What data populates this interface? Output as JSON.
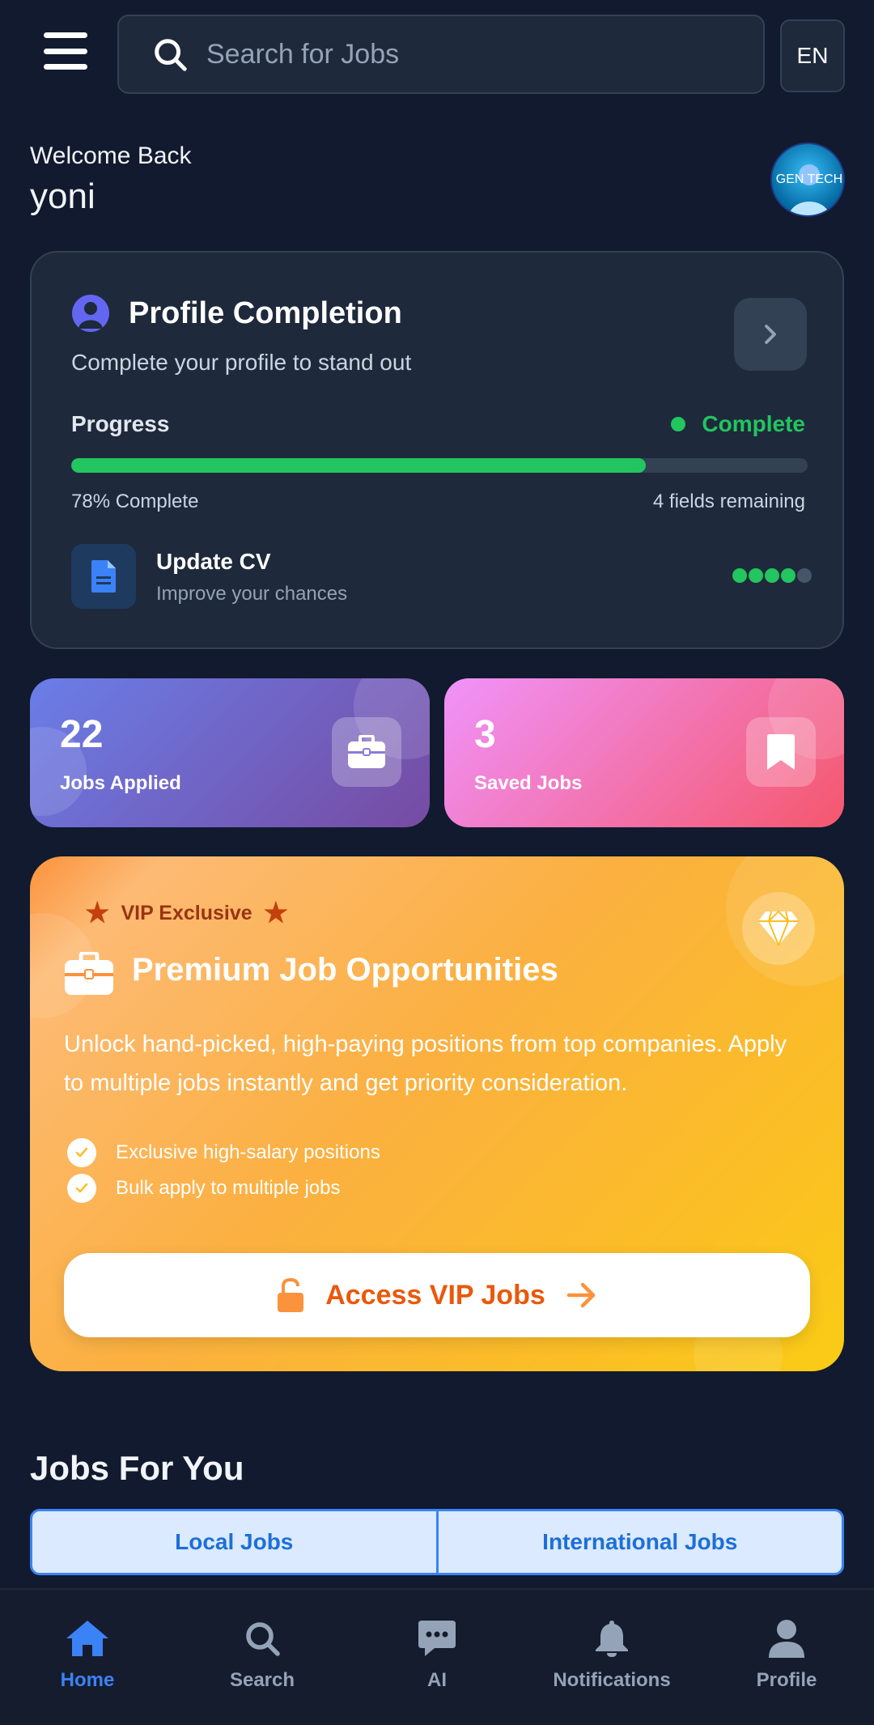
{
  "header": {
    "search_placeholder": "Search for Jobs",
    "language": "EN"
  },
  "greeting": {
    "welcome": "Welcome Back",
    "username": "yoni",
    "avatar_text": "GEN TECH"
  },
  "profile_completion": {
    "title": "Profile Completion",
    "subtitle": "Complete your profile to stand out",
    "progress_label": "Progress",
    "status": "Complete",
    "percent": 78,
    "percent_text": "78% Complete",
    "remaining_text": "4 fields remaining",
    "cv_title": "Update CV",
    "cv_subtitle": "Improve your chances",
    "cv_dots_filled": 4,
    "cv_dots_total": 5
  },
  "stats": {
    "applied_count": "22",
    "applied_label": "Jobs Applied",
    "saved_count": "3",
    "saved_label": "Saved Jobs"
  },
  "vip": {
    "badge": "VIP Exclusive",
    "title": "Premium Job Opportunities",
    "description": "Unlock hand-picked, high-paying positions from top companies. Apply to multiple jobs instantly and get priority consideration.",
    "features": [
      "Exclusive high-salary positions",
      "Bulk apply to multiple jobs"
    ],
    "button_label": "Access VIP Jobs"
  },
  "jobs": {
    "title": "Jobs For You",
    "tabs": [
      "Local Jobs",
      "International Jobs"
    ]
  },
  "nav": {
    "items": [
      "Home",
      "Search",
      "AI",
      "Notifications",
      "Profile"
    ],
    "active": "Home"
  },
  "colors": {
    "background": "#111a2e",
    "card": "#1e293b",
    "accent_green": "#22c55e",
    "accent_blue": "#3b82f6",
    "vip_orange": "#ea580c"
  }
}
